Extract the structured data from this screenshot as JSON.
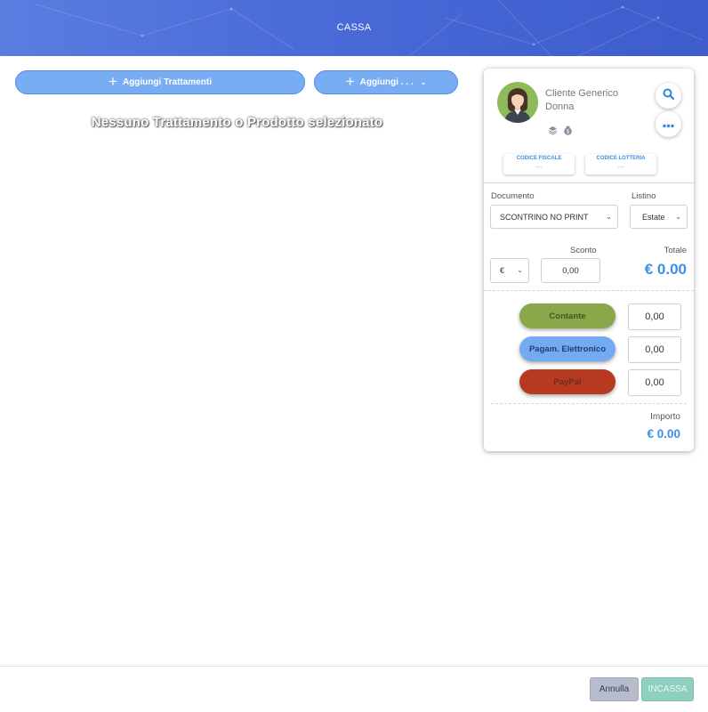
{
  "header": {
    "title": "CASSA"
  },
  "toolbar": {
    "add_treatments_label": "Aggiungi Trattamenti",
    "add_more_label": "Aggiungi . . ."
  },
  "main": {
    "empty_message": "Nessuno Trattamento o Prodotto selezionato"
  },
  "client": {
    "name_line1": "Cliente Generico",
    "name_line2": "Donna",
    "avatar_icon": "woman-avatar-icon",
    "search_icon": "search-icon",
    "more_icon": "more-dots-icon"
  },
  "codes": {
    "fiscal_label": "CODICE FISCALE",
    "fiscal_value": "---",
    "lottery_label": "CODICE LOTTERIA",
    "lottery_value": "---"
  },
  "document": {
    "label": "Documento",
    "value": "SCONTRINO NO PRINT",
    "listino_label": "Listino",
    "listino_value": "Estate"
  },
  "discount": {
    "currency": "€",
    "label": "Sconto",
    "value": "0,00",
    "total_label": "Totale",
    "total_value": "€ 0.00"
  },
  "payments": [
    {
      "label": "Contante",
      "amount": "0,00",
      "color": "#8aa84a",
      "text_color": "#3f5a23"
    },
    {
      "label": "Pagam. Elettronico",
      "amount": "0,00",
      "color": "#74aaf2",
      "text_color": "#1e3f7a"
    },
    {
      "label": "PayPal",
      "amount": "0,00",
      "color": "#b73a20",
      "text_color": "#6e2b1c"
    }
  ],
  "importo": {
    "label": "Importo",
    "value": "€ 0.00"
  },
  "footer": {
    "cancel_label": "Annulla",
    "confirm_label": "INCASSA"
  },
  "colors": {
    "accent": "#3b8fe6",
    "header": "#4a6ad8",
    "button": "#78acf3"
  }
}
